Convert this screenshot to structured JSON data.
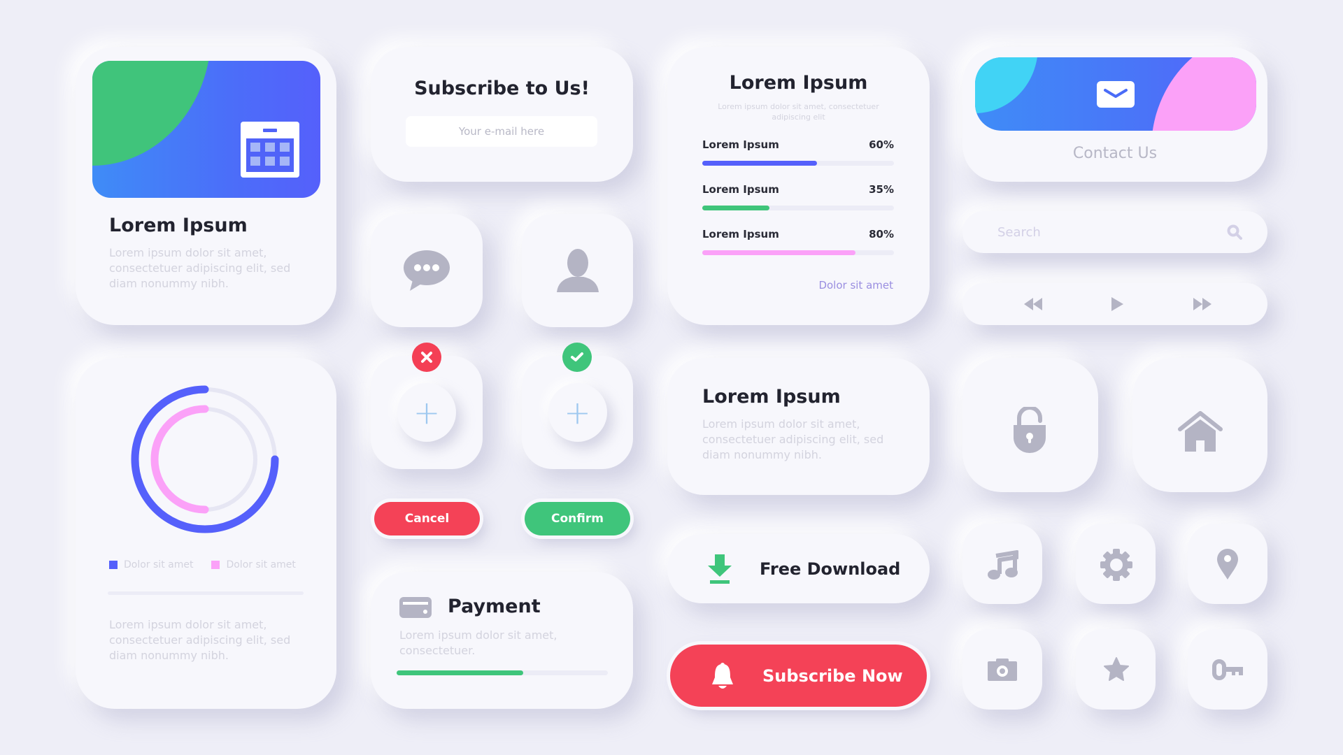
{
  "colors": {
    "background": "#eeeef7",
    "card": "#f7f7fc",
    "blue": "#5560fb",
    "green": "#3fc57b",
    "pink": "#fba1f8",
    "red": "#f44257",
    "cyan": "#41d3f5",
    "icon_gray": "#b4b4c4",
    "link_purple": "#9a8ee0"
  },
  "feature_card": {
    "icon": "calendar-icon",
    "title": "Lorem Ipsum",
    "description": "Lorem ipsum dolor sit amet, consectetuer adipiscing elit, sed diam nonummy nibh."
  },
  "subscribe_card": {
    "title": "Subscribe to Us!",
    "email_placeholder": "Your e-mail here",
    "email_value": ""
  },
  "icon_tiles": {
    "chat": "chat-bubble-icon",
    "user": "user-icon",
    "add": "plus-icon",
    "error_badge": "close-icon",
    "success_badge": "check-icon"
  },
  "buttons": {
    "cancel": "Cancel",
    "confirm": "Confirm",
    "free_download": "Free Download",
    "subscribe_now": "Subscribe Now"
  },
  "payment_card": {
    "icon": "credit-card-icon",
    "title": "Payment",
    "description": "Lorem ipsum dolor sit amet, consectetuer.",
    "progress_percent": 60
  },
  "donut_card": {
    "rings": [
      {
        "label": "Dolor sit amet",
        "percent": 75,
        "color": "#5560fb"
      },
      {
        "label": "Dolor sit amet",
        "percent": 50,
        "color": "#fba1f8"
      }
    ],
    "description": "Lorem ipsum dolor sit amet, consectetuer adipiscing elit, sed diam nonummy nibh."
  },
  "progress_card": {
    "title": "Lorem Ipsum",
    "subtitle": "Lorem ipsum dolor sit amet, consectetuer adipiscing elit",
    "rows": [
      {
        "label": "Lorem Ipsum",
        "value_text": "60%",
        "percent": 60,
        "color": "#5560fb"
      },
      {
        "label": "Lorem Ipsum",
        "value_text": "35%",
        "percent": 35,
        "color": "#3fc57b"
      },
      {
        "label": "Lorem Ipsum",
        "value_text": "80%",
        "percent": 80,
        "color": "#fba1f8"
      }
    ],
    "link": "Dolor sit amet"
  },
  "info_card": {
    "title": "Lorem Ipsum",
    "description": "Lorem ipsum dolor sit amet, consectetuer adipiscing elit, sed diam nonummy nibh."
  },
  "contact_card": {
    "icon": "mail-icon",
    "label": "Contact Us"
  },
  "search": {
    "placeholder": "Search",
    "value": ""
  },
  "media_controls": [
    "rewind-icon",
    "play-icon",
    "fast-forward-icon"
  ],
  "icon_grid": [
    "lock-icon",
    "home-icon",
    "music-note-icon",
    "gear-icon",
    "location-pin-icon",
    "camera-icon",
    "star-icon",
    "key-icon"
  ]
}
